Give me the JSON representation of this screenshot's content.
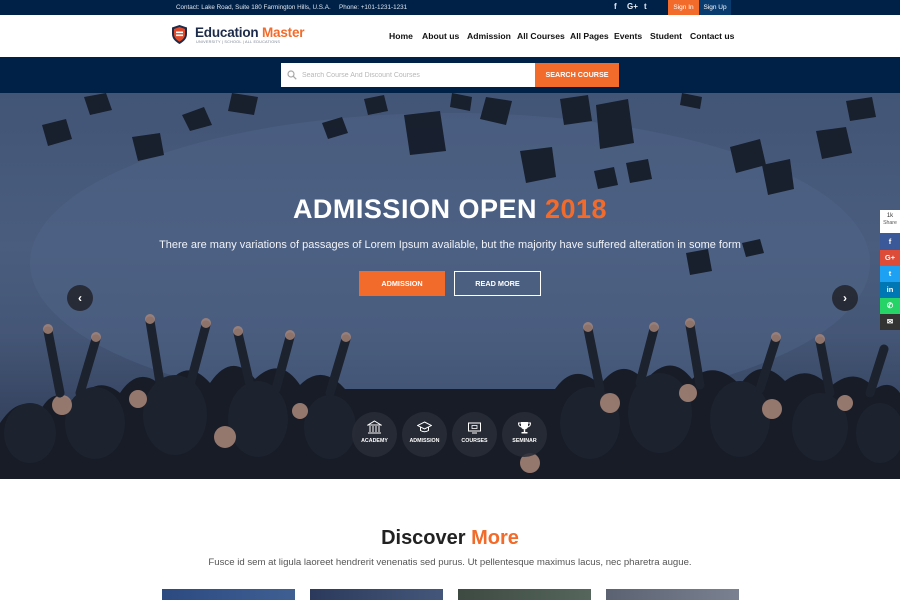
{
  "topbar": {
    "contact": "Contact: Lake Road, Suite 180 Farmington Hills, U.S.A.",
    "phone": "Phone: +101-1231-1231",
    "social": [
      {
        "icon": "facebook-icon",
        "glyph": "f"
      },
      {
        "icon": "google-plus-icon",
        "glyph": "G+"
      },
      {
        "icon": "twitter-icon",
        "glyph": "t"
      }
    ],
    "sign_in": "Sign In",
    "sign_up": "Sign Up"
  },
  "header": {
    "logo": {
      "title_main": "Education ",
      "title_accent": "Master",
      "tagline": "UNIVERSITY | SCHOOL | ALL EDUCATIONS"
    },
    "nav": [
      "Home",
      "About us",
      "Admission",
      "All Courses",
      "All Pages",
      "Events",
      "Student",
      "Contact us"
    ]
  },
  "search": {
    "placeholder": "Search Course And Discount Courses",
    "button": "SEARCH COURSE"
  },
  "hero": {
    "title_main": "ADMISSION OPEN ",
    "title_accent": "2018",
    "subtitle": "There are many variations of passages of Lorem Ipsum available, but the majority have suffered alteration in some form",
    "btn_primary": "ADMISSION",
    "btn_secondary": "READ MORE",
    "prev_glyph": "‹",
    "next_glyph": "›",
    "quick_links": [
      {
        "label": "ACADEMY",
        "icon": "academy-building-icon"
      },
      {
        "label": "ADMISSION",
        "icon": "graduation-cap-icon"
      },
      {
        "label": "COURSES",
        "icon": "screen-icon"
      },
      {
        "label": "SEMINAR",
        "icon": "trophy-icon"
      }
    ]
  },
  "share": {
    "count": "1k",
    "label": "Share",
    "items": [
      {
        "icon": "facebook-icon",
        "glyph": "f",
        "color": "#3b5998"
      },
      {
        "icon": "google-plus-icon",
        "glyph": "G+",
        "color": "#dd4b39"
      },
      {
        "icon": "twitter-icon",
        "glyph": "t",
        "color": "#1da1f2"
      },
      {
        "icon": "linkedin-icon",
        "glyph": "in",
        "color": "#0077b5"
      },
      {
        "icon": "whatsapp-icon",
        "glyph": "✆",
        "color": "#25d366"
      },
      {
        "icon": "email-icon",
        "glyph": "✉",
        "color": "#333333"
      }
    ]
  },
  "discover": {
    "title_main": "Discover ",
    "title_accent": "More",
    "subtitle": "Fusce id sem at ligula laoreet hendrerit venenatis sed purus. Ut pellentesque maximus lacus, nec pharetra augue."
  },
  "colors": {
    "accent": "#f26b2a",
    "navy": "#002147"
  }
}
